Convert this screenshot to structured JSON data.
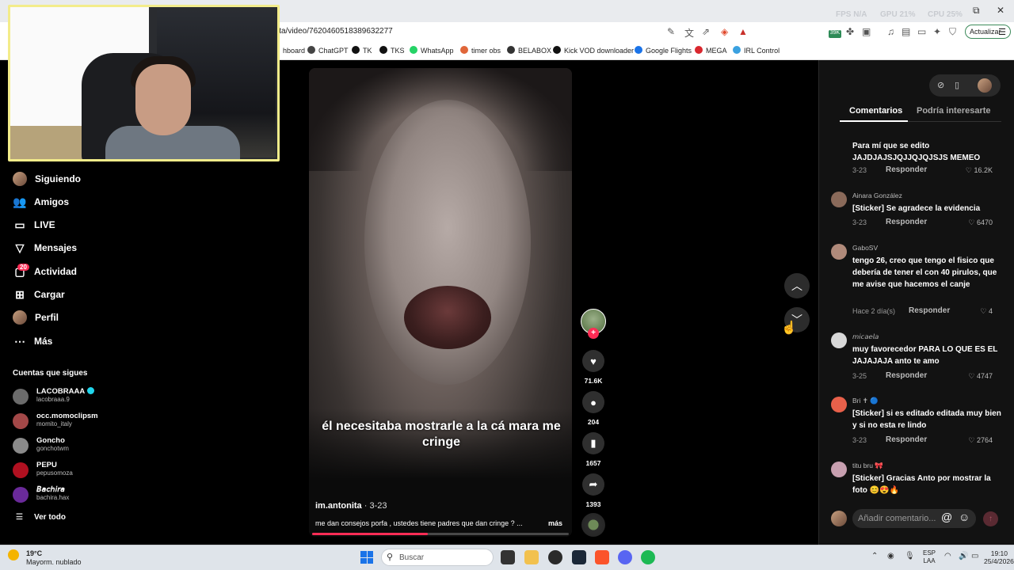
{
  "browser": {
    "url": "ita/video/7620460518389632277",
    "perf": {
      "fps": "FPS N/A",
      "gpu": "GPU 21%",
      "cpu": "CPU 25%"
    },
    "update_label": "Actualizar",
    "ext_badge": "39K",
    "bookmarks": [
      {
        "label": "hboard",
        "color": "#ffffff"
      },
      {
        "label": "ChatGPT",
        "color": "#444444"
      },
      {
        "label": "TK",
        "color": "#111111"
      },
      {
        "label": "TKS",
        "color": "#111111"
      },
      {
        "label": "WhatsApp",
        "color": "#25d366"
      },
      {
        "label": "timer obs",
        "color": "#e0663a"
      },
      {
        "label": "BELABOX",
        "color": "#333333"
      },
      {
        "label": "Kick VOD downloader",
        "color": "#111111"
      },
      {
        "label": "Google Flights",
        "color": "#1a73e8"
      },
      {
        "label": "MEGA",
        "color": "#d9272e"
      },
      {
        "label": "IRL Control",
        "color": "#3aa1e0"
      }
    ]
  },
  "nav": {
    "items": [
      {
        "label": "Siguiendo",
        "icon": "following-icon"
      },
      {
        "label": "Amigos",
        "icon": "friends-icon"
      },
      {
        "label": "LIVE",
        "icon": "live-icon"
      },
      {
        "label": "Mensajes",
        "icon": "messages-icon"
      },
      {
        "label": "Actividad",
        "icon": "activity-icon"
      },
      {
        "label": "Cargar",
        "icon": "upload-icon"
      },
      {
        "label": "Perfil",
        "icon": "profile-icon"
      },
      {
        "label": "Más",
        "icon": "more-icon"
      }
    ],
    "activity_badge": "20",
    "following_header": "Cuentas que sigues",
    "accounts": [
      {
        "name": "LACOBRAAA",
        "user": "lacobraaa.9",
        "verified": true,
        "color": "#6b6b6b"
      },
      {
        "name": "occ.momoclipsm",
        "user": "momito_italy",
        "verified": false,
        "color": "#a34848"
      },
      {
        "name": "Goncho",
        "user": "gonchotwm",
        "verified": false,
        "color": "#8a8a8a"
      },
      {
        "name": "PEPU",
        "user": "pepusomoza",
        "verified": false,
        "color": "#b01020"
      },
      {
        "name": "𝘉𝘢𝘤𝘩𝘪𝘳𝘢",
        "user": "bachira.hax",
        "verified": false,
        "color": "#6a2a9a"
      }
    ],
    "see_all": "Ver todo"
  },
  "video": {
    "caption": "él necesitaba mostrarle a la cá mara me cringe",
    "username": "im.antonita",
    "date": " · 3-23",
    "description": "me dan consejos porfa , ustedes tiene padres que dan cringe ? ...",
    "more": "más",
    "progress": 0.45,
    "likes": "71.6K",
    "comments": "204",
    "saves": "1657",
    "shares": "1393"
  },
  "panel": {
    "tab_comments": "Comentarios",
    "tab_interest": "Podría interesarte",
    "reply_label": "Responder",
    "comment_placeholder": "Añadir comentario...",
    "comments": [
      {
        "author": "",
        "text": "Para mí que se edito JAJDJAJSJQJJQJQJSJS MEMEO",
        "date": "3-23",
        "likes": "16.2K",
        "color": "#555555"
      },
      {
        "author": "Ainara González",
        "text": "[Sticker] Se agradece la evidencia",
        "date": "3-23",
        "likes": "6470",
        "color": "#8a6a5a"
      },
      {
        "author": "GaboSV",
        "text": "tengo 26, creo que tengo el fisico que debería de tener el con 40 pirulos, que me avise que hacemos el canje",
        "date": "Hace 2 día(s)",
        "likes": "4",
        "color": "#b08a7a"
      },
      {
        "author": "𝘮𝘪𝘤𝘢𝘦𝘭𝘢",
        "text": "muy favorecedor PARA LO QUE ES EL JAJAJAJA anto te amo",
        "date": "3-25",
        "likes": "4747",
        "color": "#d8d8d8"
      },
      {
        "author": "Bri ✝ 🔵",
        "text": "[Sticker] si es editado editada muy bien y si no esta re lindo",
        "date": "3-23",
        "likes": "2764",
        "color": "#e8604a"
      },
      {
        "author": "titu bru 🎀",
        "text": "[Sticker] Gracias Anto por mostrar la foto 😊😍🔥",
        "date": "",
        "likes": "",
        "color": "#c8a0b0"
      }
    ]
  },
  "taskbar": {
    "temp": "19°C",
    "weather": "Mayorm. nublado",
    "search": "Buscar",
    "lang1": "ESP",
    "lang2": "LAA",
    "time": "19:10",
    "date": "25/4/2026"
  }
}
